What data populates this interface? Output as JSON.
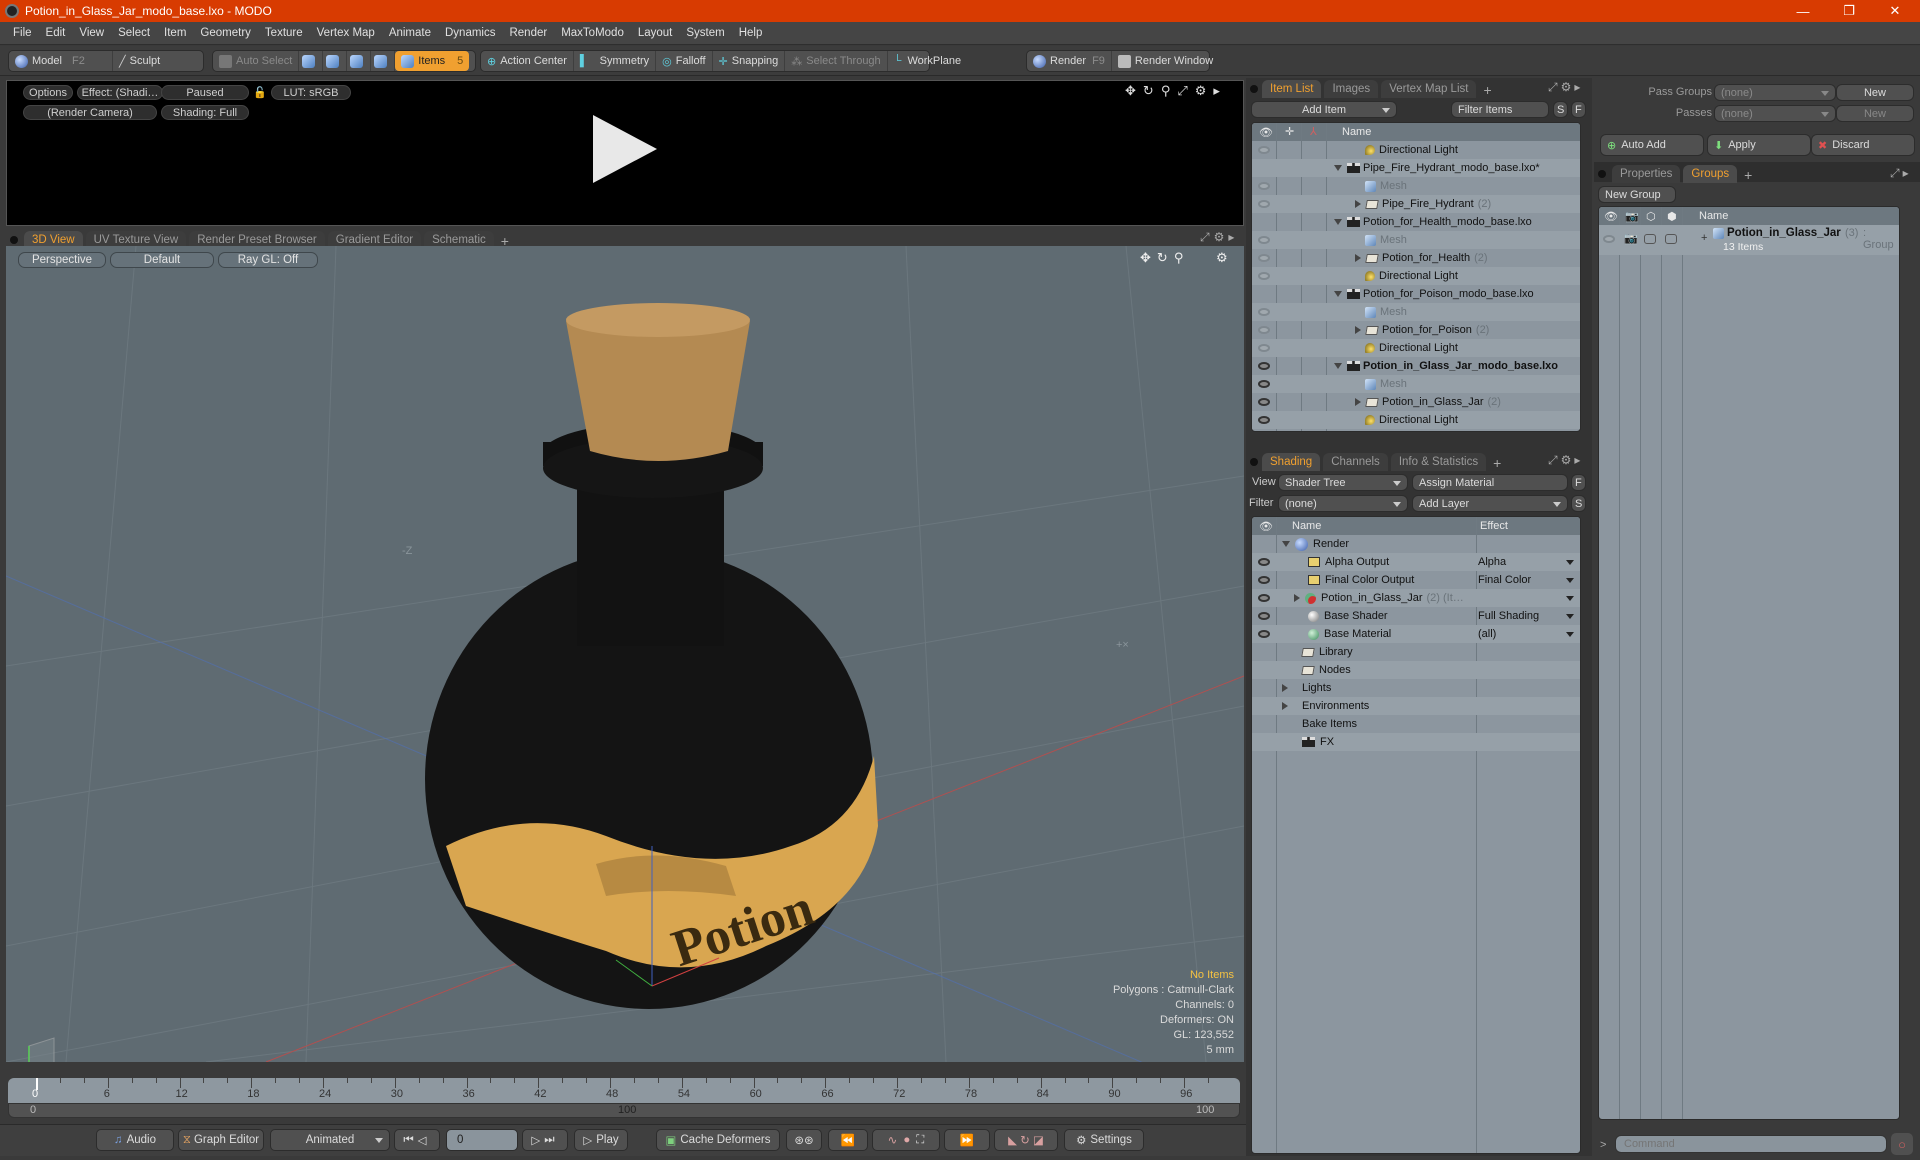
{
  "window": {
    "title": "Potion_in_Glass_Jar_modo_base.lxo - MODO",
    "minimize": "—",
    "maximize": "❐",
    "close": "✕"
  },
  "menu": [
    "File",
    "Edit",
    "View",
    "Select",
    "Item",
    "Geometry",
    "Texture",
    "Vertex Map",
    "Animate",
    "Dynamics",
    "Render",
    "MaxToModo",
    "Layout",
    "System",
    "Help"
  ],
  "toolbar": {
    "model": "Model",
    "model_key": "F2",
    "sculpt": "Sculpt",
    "auto_select": "Auto Select",
    "items": "Items",
    "items_key": "5",
    "action_center": "Action Center",
    "symmetry": "Symmetry",
    "falloff": "Falloff",
    "snapping": "Snapping",
    "select_through": "Select Through",
    "workplane": "WorkPlane",
    "render": "Render",
    "render_key": "F9",
    "render_window": "Render Window"
  },
  "render_preview": {
    "options": "Options",
    "effect": "Effect: (Shadi…",
    "paused": "Paused",
    "lut": "LUT: sRGB",
    "camera": "(Render Camera)",
    "shading": "Shading: Full"
  },
  "viewport_tabs": [
    "3D View",
    "UV Texture View",
    "Render Preset Browser",
    "Gradient Editor",
    "Schematic"
  ],
  "viewport": {
    "projection": "Perspective",
    "style": "Default",
    "raygl": "Ray GL: Off",
    "label_text": "Potion",
    "axis_label": "-Z",
    "stats": {
      "items": "No Items",
      "polygons": "Polygons : Catmull-Clark",
      "channels": "Channels: 0",
      "deformers": "Deformers: ON",
      "gl": "GL: 123,552",
      "unit": "5 mm"
    },
    "colors": {
      "items_highlight": "#f5c242",
      "tab_active": "#f0a030"
    }
  },
  "timeline": {
    "ticks": [
      "0",
      "6",
      "12",
      "18",
      "24",
      "30",
      "36",
      "42",
      "48",
      "54",
      "60",
      "66",
      "72",
      "78",
      "84",
      "90",
      "96"
    ],
    "range_start": "0",
    "range_mid": "100",
    "range_end": "100"
  },
  "bottombar": {
    "audio": "Audio",
    "graph_editor": "Graph Editor",
    "mode": "Animated",
    "frame": "0",
    "play": "Play",
    "cache": "Cache Deformers",
    "settings": "Settings"
  },
  "item_list": {
    "tabs": [
      "Item List",
      "Images",
      "Vertex Map List"
    ],
    "add_item": "Add Item",
    "filter": "Filter Items",
    "s": "S",
    "f": "F",
    "name_header": "Name",
    "rows": [
      {
        "label": "Directional Light",
        "type": "light",
        "indent": 2,
        "eye": "dim"
      },
      {
        "label": "Pipe_Fire_Hydrant_modo_base.lxo*",
        "type": "scene",
        "indent": 1,
        "eye": "none"
      },
      {
        "label": "Mesh",
        "type": "mesh",
        "indent": 2,
        "eye": "dim"
      },
      {
        "label": "Pipe_Fire_Hydrant",
        "count": "(2)",
        "type": "folder",
        "indent": 2,
        "eye": "dim"
      },
      {
        "label": "Potion_for_Health_modo_base.lxo",
        "type": "scene",
        "indent": 1,
        "eye": "none"
      },
      {
        "label": "Mesh",
        "type": "mesh",
        "indent": 2,
        "eye": "dim"
      },
      {
        "label": "Potion_for_Health",
        "count": "(2)",
        "type": "folder",
        "indent": 2,
        "eye": "dim"
      },
      {
        "label": "Directional Light",
        "type": "light",
        "indent": 2,
        "eye": "dim"
      },
      {
        "label": "Potion_for_Poison_modo_base.lxo",
        "type": "scene",
        "indent": 1,
        "eye": "none"
      },
      {
        "label": "Mesh",
        "type": "mesh",
        "indent": 2,
        "eye": "dim"
      },
      {
        "label": "Potion_for_Poison",
        "count": "(2)",
        "type": "folder",
        "indent": 2,
        "eye": "dim"
      },
      {
        "label": "Directional Light",
        "type": "light",
        "indent": 2,
        "eye": "dim"
      },
      {
        "label": "Potion_in_Glass_Jar_modo_base.lxo",
        "type": "scene",
        "indent": 1,
        "eye": "on",
        "bold": true
      },
      {
        "label": "Mesh",
        "type": "mesh",
        "indent": 2,
        "eye": "on"
      },
      {
        "label": "Potion_in_Glass_Jar",
        "count": "(2)",
        "type": "folder",
        "indent": 2,
        "eye": "on"
      },
      {
        "label": "Directional Light",
        "type": "light",
        "indent": 2,
        "eye": "on"
      }
    ]
  },
  "shading": {
    "tabs": [
      "Shading",
      "Channels",
      "Info & Statistics"
    ],
    "view_label": "View",
    "view_value": "Shader Tree",
    "assign_material": "Assign Material",
    "filter_label": "Filter",
    "filter_value": "(none)",
    "add_layer": "Add Layer",
    "f": "F",
    "s": "S",
    "name_header": "Name",
    "effect_header": "Effect",
    "rows": [
      {
        "label": "Render",
        "effect": "",
        "eye": false,
        "icon": "render"
      },
      {
        "label": "Alpha Output",
        "effect": "Alpha",
        "eye": true,
        "icon": "output"
      },
      {
        "label": "Final Color Output",
        "effect": "Final Color",
        "eye": true,
        "icon": "output"
      },
      {
        "label": "Potion_in_Glass_Jar",
        "extra": "(2) (It…",
        "effect": "",
        "eye": true,
        "icon": "material-group"
      },
      {
        "label": "Base Shader",
        "effect": "Full Shading",
        "eye": true,
        "icon": "shader"
      },
      {
        "label": "Base Material",
        "effect": "(all)",
        "eye": true,
        "icon": "material"
      },
      {
        "label": "Library",
        "effect": "",
        "eye": false,
        "icon": "folder"
      },
      {
        "label": "Nodes",
        "effect": "",
        "eye": false,
        "icon": "folder"
      },
      {
        "label": "Lights",
        "effect": "",
        "eye": false,
        "icon": "expand"
      },
      {
        "label": "Environments",
        "effect": "",
        "eye": false,
        "icon": "expand"
      },
      {
        "label": "Bake Items",
        "effect": "",
        "eye": false,
        "icon": "none"
      },
      {
        "label": "FX",
        "effect": "",
        "eye": false,
        "icon": "scene"
      }
    ]
  },
  "passes": {
    "pass_groups_label": "Pass Groups",
    "pass_groups_value": "(none)",
    "new": "New",
    "passes_label": "Passes",
    "passes_value": "(none)",
    "auto_add": "Auto Add",
    "apply": "Apply",
    "discard": "Discard"
  },
  "groups": {
    "tabs": [
      "Properties",
      "Groups"
    ],
    "new_group": "New Group",
    "name_header": "Name",
    "item": {
      "name": "Potion_in_Glass_Jar",
      "count": "(3)",
      "type": ": Group",
      "sub": "13 Items"
    }
  },
  "command": {
    "prompt": ">",
    "placeholder": "Command"
  }
}
